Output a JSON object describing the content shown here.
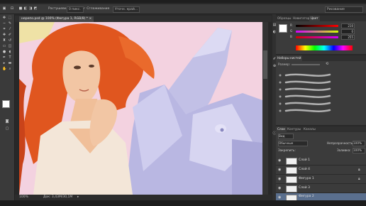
{
  "app": {
    "name": "Adobe Photoshop"
  },
  "options_bar": {
    "brush_setting_label": "Растушевка:",
    "brush_setting_value": "0 пикс.",
    "anti_alias_label": "Сглаживание",
    "refine_edge_label": "Уточн. край...",
    "workspace_label": "Рисование"
  },
  "document": {
    "tab_title": "нерепо.psd @ 100% (Фигура 1, RGB/8) *",
    "zoom": "100%",
    "doc_size": "Док: 3,43M/30,1M"
  },
  "color_panel": {
    "tabs": [
      "Образцы",
      "Навигатор",
      "Цвет"
    ],
    "active_tab": "Цвет",
    "channels": [
      {
        "label": "R",
        "value": "210",
        "color": "#d2d2f5"
      },
      {
        "label": "G",
        "value": "0",
        "color": "#d2d2f5"
      },
      {
        "label": "B",
        "value": "255",
        "color": "#d2d2f5"
      }
    ],
    "foreground": "#ffffff",
    "background": "#1a1a1a"
  },
  "brush_panel": {
    "tabs": [
      "Наборы кистей"
    ],
    "size_label": "Размер:"
  },
  "layers_panel": {
    "tabs": [
      "Слои",
      "Контуры",
      "Каналы"
    ],
    "kind_filter": "Вид",
    "blend_mode": "Обычные",
    "opacity_label": "Непрозрачность:",
    "opacity_value": "100%",
    "lock_label": "Закрепить:",
    "fill_label": "Заливка:",
    "fill_value": "100%",
    "layers": [
      {
        "name": "Слой 1",
        "selected": false
      },
      {
        "name": "Слой 4",
        "selected": false
      },
      {
        "name": "Фигура 1",
        "selected": false
      },
      {
        "name": "Слой 3",
        "selected": false
      },
      {
        "name": "Фигура 2",
        "selected": true
      }
    ]
  },
  "colors": {
    "ui_dark": "#282828",
    "panel": "#3b3b3b",
    "selection": "#5a6f8e",
    "canvas_bg": "#f3d2e0",
    "robot": "#c6c4e6",
    "hair": "#e0561f"
  }
}
